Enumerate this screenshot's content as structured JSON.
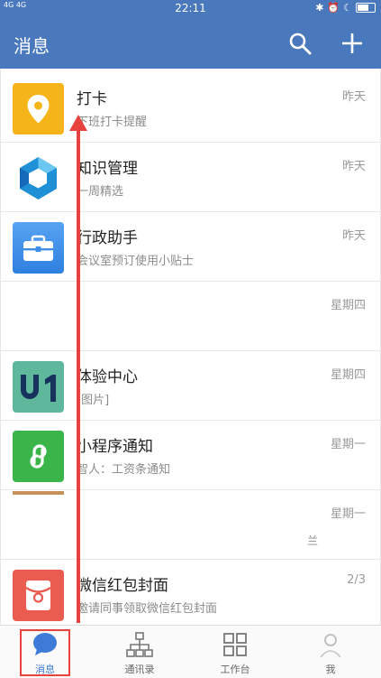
{
  "statusbar": {
    "network": "4G 4G",
    "time": "22:11",
    "icons": [
      "bluetooth-icon",
      "alarm-icon",
      "moon-icon",
      "battery-icon"
    ]
  },
  "header": {
    "title": "消息",
    "search_icon": "search-icon",
    "add_icon": "plus-icon",
    "color": "#4a78bd"
  },
  "messages": [
    {
      "title": "打卡",
      "subtitle": "下班打卡提醒",
      "time": "昨天",
      "icon": "location-pin-icon",
      "color": "#f5b51a"
    },
    {
      "title": "知识管理",
      "subtitle": "一周精选",
      "time": "昨天",
      "icon": "knowledge-hexagon-icon",
      "color": "#1f8fd6"
    },
    {
      "title": "行政助手",
      "subtitle": "会议室预订使用小贴士",
      "time": "昨天",
      "icon": "briefcase-icon",
      "color": "#3f8ee8"
    },
    {
      "title": "",
      "subtitle": "",
      "time": "星期四",
      "icon": "",
      "color": "#ffffff"
    },
    {
      "title": "体验中心",
      "subtitle": "[图片]",
      "time": "星期四",
      "icon": "u1-logo-icon",
      "color": "#5fb89b"
    },
    {
      "title": "小程序通知",
      "subtitle": "智人：工资条通知",
      "time": "星期一",
      "icon": "mini-program-icon",
      "color": "#39b54a"
    },
    {
      "title": "",
      "subtitle": "",
      "time": "星期一",
      "extra": "兰",
      "icon": "",
      "color": "#ffffff"
    },
    {
      "title": "微信红包封面",
      "subtitle": "邀请同事领取微信红包封面",
      "time": "2/3",
      "icon": "red-envelope-icon",
      "color": "#ea5c4f"
    }
  ],
  "tabs": [
    {
      "label": "消息",
      "icon": "chat-bubble-icon",
      "active": true
    },
    {
      "label": "通讯录",
      "icon": "org-chart-icon",
      "active": false
    },
    {
      "label": "工作台",
      "icon": "grid-icon",
      "active": false
    },
    {
      "label": "我",
      "icon": "person-icon",
      "active": false
    }
  ],
  "accent": "#3e7bd8",
  "annotation_color": "#e8423e"
}
